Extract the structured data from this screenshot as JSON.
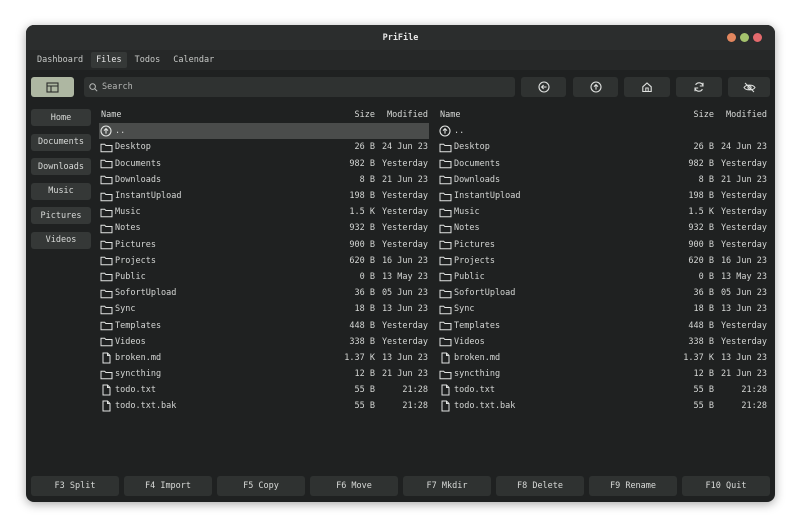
{
  "window": {
    "title": "PriFile",
    "controls": [
      {
        "name": "minimize",
        "color": "#e2865e"
      },
      {
        "name": "maximize",
        "color": "#a5c26d"
      },
      {
        "name": "close",
        "color": "#e46a6d"
      }
    ]
  },
  "menu": {
    "items": [
      "Dashboard",
      "Files",
      "Todos",
      "Calendar"
    ],
    "active": "Files"
  },
  "toolbar": {
    "search_placeholder": "Search",
    "buttons": [
      "layout-icon",
      "back-icon",
      "up-icon",
      "home-icon",
      "refresh-icon",
      "hide-hidden-icon"
    ]
  },
  "sidebar": {
    "items": [
      "Home",
      "Documents",
      "Downloads",
      "Music",
      "Pictures",
      "Videos"
    ]
  },
  "columns": {
    "name": "Name",
    "size": "Size",
    "modified": "Modified"
  },
  "parent_entry": "..",
  "files": [
    {
      "name": "Desktop",
      "type": "folder",
      "size": "26 B",
      "modified": "24 Jun 23"
    },
    {
      "name": "Documents",
      "type": "folder",
      "size": "982 B",
      "modified": "Yesterday"
    },
    {
      "name": "Downloads",
      "type": "folder",
      "size": "8 B",
      "modified": "21 Jun 23"
    },
    {
      "name": "InstantUpload",
      "type": "folder",
      "size": "198 B",
      "modified": "Yesterday"
    },
    {
      "name": "Music",
      "type": "folder",
      "size": "1.5 K",
      "modified": "Yesterday"
    },
    {
      "name": "Notes",
      "type": "folder",
      "size": "932 B",
      "modified": "Yesterday"
    },
    {
      "name": "Pictures",
      "type": "folder",
      "size": "900 B",
      "modified": "Yesterday"
    },
    {
      "name": "Projects",
      "type": "folder",
      "size": "620 B",
      "modified": "16 Jun 23"
    },
    {
      "name": "Public",
      "type": "folder",
      "size": "0 B",
      "modified": "13 May 23"
    },
    {
      "name": "SofortUpload",
      "type": "folder",
      "size": "36 B",
      "modified": "05 Jun 23"
    },
    {
      "name": "Sync",
      "type": "folder",
      "size": "18 B",
      "modified": "13 Jun 23"
    },
    {
      "name": "Templates",
      "type": "folder",
      "size": "448 B",
      "modified": "Yesterday"
    },
    {
      "name": "Videos",
      "type": "folder",
      "size": "338 B",
      "modified": "Yesterday"
    },
    {
      "name": "broken.md",
      "type": "file",
      "size": "1.37 K",
      "modified": "13 Jun 23"
    },
    {
      "name": "syncthing",
      "type": "folder",
      "size": "12 B",
      "modified": "21 Jun 23"
    },
    {
      "name": "todo.txt",
      "type": "file",
      "size": "55 B",
      "modified": "21:28"
    },
    {
      "name": "todo.txt.bak",
      "type": "file",
      "size": "55 B",
      "modified": "21:28"
    }
  ],
  "function_keys": [
    "F3 Split",
    "F4 Import",
    "F5 Copy",
    "F6 Move",
    "F7 Mkdir",
    "F8 Delete",
    "F9 Rename",
    "F10 Quit"
  ],
  "colors": {
    "accent": "#aeb7a2",
    "background": "#1f2121",
    "selection": "#4a4c4b"
  }
}
